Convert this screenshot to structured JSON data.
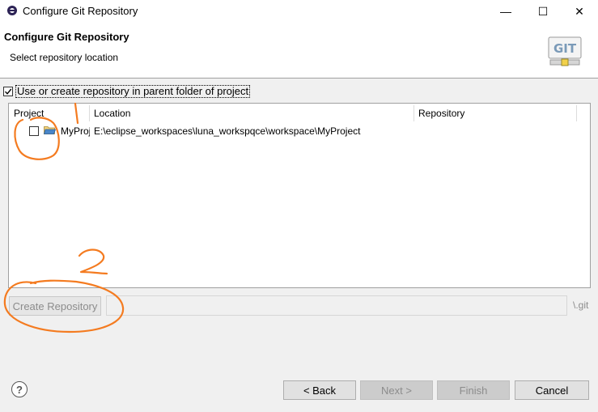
{
  "window": {
    "title": "Configure Git Repository",
    "controls": {
      "minimize": "—",
      "maximize": "☐",
      "close": "✕"
    }
  },
  "header": {
    "title": "Configure Git Repository",
    "description": "Select repository location",
    "logo_text": "GIT"
  },
  "use_parent": {
    "label": "Use or create repository in parent folder of project",
    "checked": true
  },
  "table": {
    "columns": [
      "Project",
      "Location",
      "Repository"
    ],
    "rows": [
      {
        "project": "MyProject",
        "location": "E:\\eclipse_workspaces\\luna_workspqce\\workspace\\MyProject",
        "repository": "",
        "checked": false
      }
    ]
  },
  "create_repository": {
    "button_label": "Create Repository",
    "path_value": "",
    "suffix": "\\.git"
  },
  "footer": {
    "help_icon": "?",
    "back_label": "< Back",
    "next_label": "Next >",
    "finish_label": "Finish",
    "cancel_label": "Cancel"
  },
  "annotations": {
    "mark_1": "1",
    "mark_2": "2",
    "color": "#f47b20"
  }
}
